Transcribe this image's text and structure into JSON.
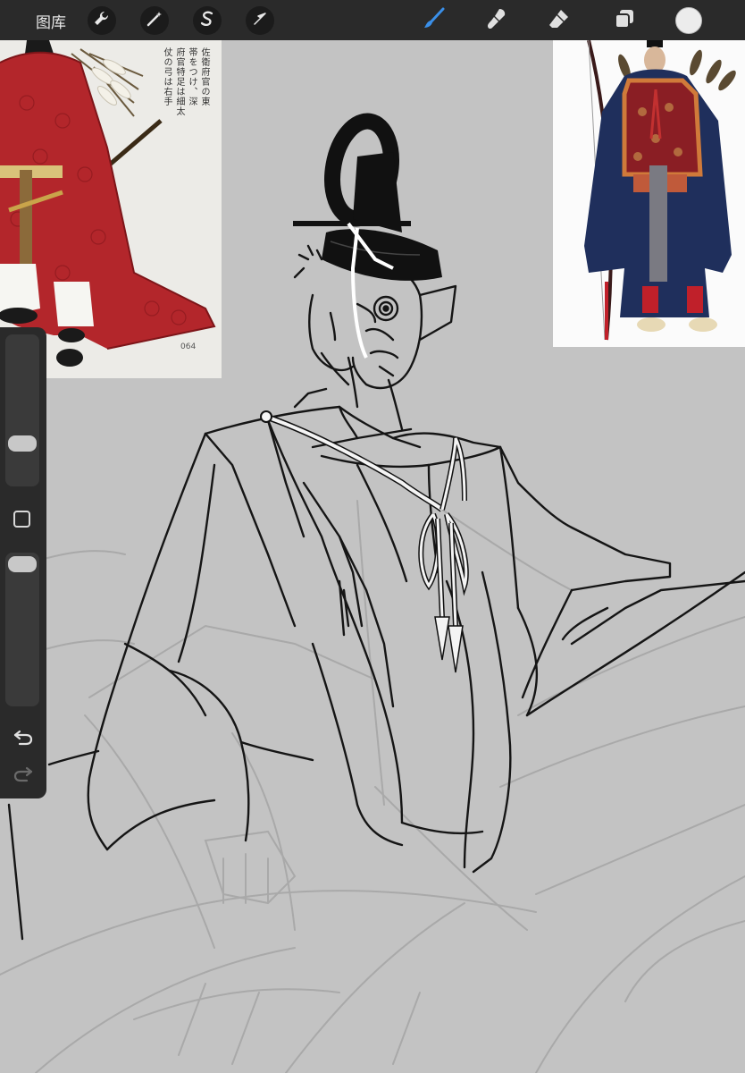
{
  "toolbar": {
    "gallery_label": "图库",
    "left_tools": [
      {
        "icon": "wrench-icon",
        "name": "actions"
      },
      {
        "icon": "magic-wand-icon",
        "name": "adjustments"
      },
      {
        "icon": "selection-s-icon",
        "name": "selection"
      },
      {
        "icon": "arrow-cursor-icon",
        "name": "transform"
      }
    ],
    "right_tools": [
      {
        "icon": "brush-icon",
        "name": "paint",
        "active": true
      },
      {
        "icon": "smudge-icon",
        "name": "smudge"
      },
      {
        "icon": "eraser-icon",
        "name": "eraser"
      },
      {
        "icon": "layers-icon",
        "name": "layers"
      }
    ],
    "current_color": "#ececec",
    "active_tool_color": "#3a8fe8"
  },
  "reference_left": {
    "text_columns": [
      "佐衛府官の東",
      "帯をつけ、深",
      "府官特足は細太",
      "仗の弓は右手"
    ],
    "page_number": "064",
    "robe_color": "#b3262b"
  },
  "reference_right": {
    "robe_color": "#1f2f5c",
    "vest_color": "#8a1e24"
  },
  "sidebar": {
    "brush_size_level": 0.72,
    "opacity_level": 0.03,
    "icons": [
      "modify-square-icon",
      "undo-icon",
      "redo-icon"
    ]
  }
}
